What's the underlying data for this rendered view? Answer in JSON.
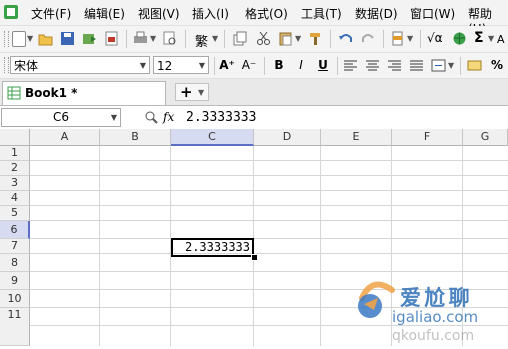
{
  "menu": {
    "items": [
      "文件(F)",
      "编辑(E)",
      "视图(V)",
      "插入(I)",
      "格式(O)",
      "工具(T)",
      "数据(D)",
      "窗口(W)",
      "帮助(H)"
    ]
  },
  "toolbar_format": {
    "font_name": "宋体",
    "font_size": "12",
    "grow_font_label": "A⁺",
    "shrink_font_label": "A⁻",
    "bold_label": "B",
    "italic_label": "I",
    "underline_label": "U",
    "percent_label": "%"
  },
  "toolbar_standard": {
    "traditional_label": "繁",
    "formula_label": "√α",
    "sum_label": "Σ"
  },
  "tabs": {
    "workbook_label": "Book1 *",
    "new_tab_label": "+"
  },
  "formula_bar": {
    "name_box": "C6",
    "value": "2.3333333"
  },
  "sheet": {
    "columns": [
      "A",
      "B",
      "C",
      "D",
      "E",
      "F",
      "G"
    ],
    "rows": [
      "1",
      "2",
      "3",
      "4",
      "5",
      "6",
      "7",
      "8",
      "9",
      "10",
      "11"
    ],
    "active_cell": "C6",
    "active_cell_value": "2.3333333"
  },
  "watermark": {
    "text_cn": "爱 尬 聊",
    "url_1": "igaliao.com",
    "url_2": "qkoufu.com"
  },
  "colors": {
    "selected_header": "#d7dbf2",
    "selected_header_accent": "#5b6ec4"
  }
}
